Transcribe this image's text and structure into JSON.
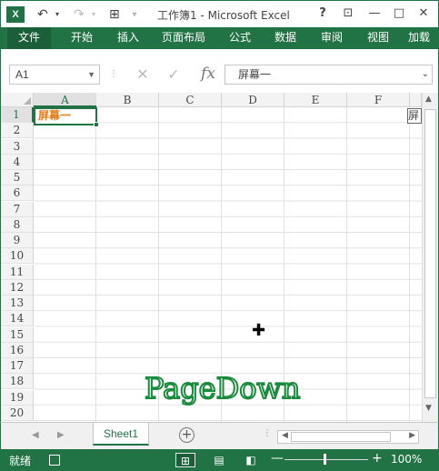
{
  "app": {
    "title": "工作簿1 - Microsoft Excel",
    "logo_text": "X",
    "colors": {
      "brand": "#217346",
      "active_cell_text": "#e67a19"
    }
  },
  "qat": {
    "undo_icon": "undo-icon",
    "redo_icon": "redo-icon",
    "grid_icon": "border-icon"
  },
  "window": {
    "help": "?",
    "restore_ribbon": "⊡",
    "minimize": "—",
    "maximize": "□",
    "close": "✕"
  },
  "ribbon": {
    "tabs": [
      "文件",
      "开始",
      "插入",
      "页面布局",
      "公式",
      "数据",
      "审阅",
      "视图",
      "加载"
    ]
  },
  "formula_bar": {
    "name_box": "A1",
    "formula_value": "屏幕一",
    "fx_label": "fx"
  },
  "grid": {
    "columns": [
      "A",
      "B",
      "C",
      "D",
      "E",
      "F"
    ],
    "rows": [
      "1",
      "2",
      "3",
      "4",
      "5",
      "6",
      "7",
      "8",
      "9",
      "10",
      "11",
      "12",
      "13",
      "14",
      "15",
      "16",
      "17",
      "18",
      "19",
      "20"
    ],
    "active_cell": {
      "ref": "A1",
      "value": "屏幕一"
    },
    "overflow_text": "屏",
    "overlay_text": "PageDown"
  },
  "sheets": {
    "tabs": [
      "Sheet1"
    ],
    "active": "Sheet1",
    "add_label": "+"
  },
  "status": {
    "ready": "就绪",
    "zoom": "100%"
  }
}
